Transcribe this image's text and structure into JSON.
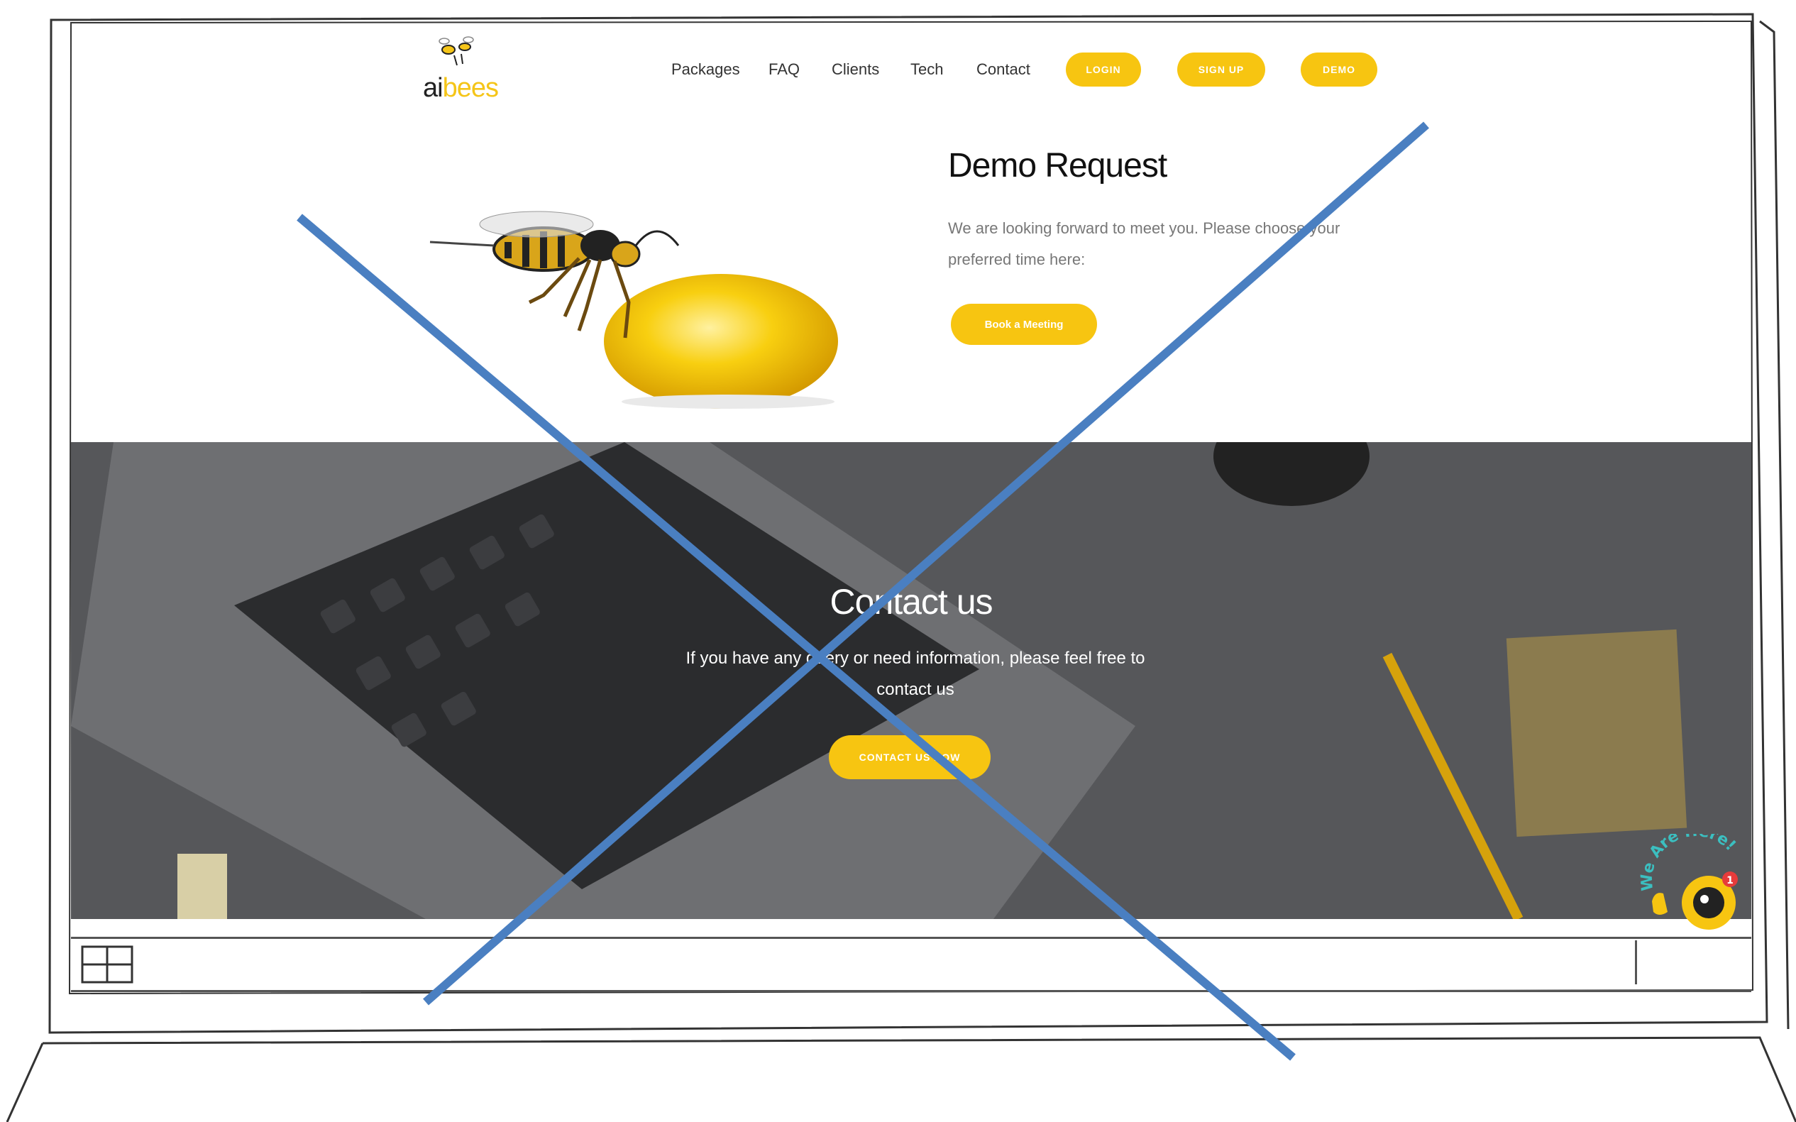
{
  "logo": {
    "ai": "ai",
    "bees": "bees"
  },
  "nav": {
    "links": [
      "Packages",
      "FAQ",
      "Clients",
      "Tech",
      "Contact"
    ],
    "login": "LOGIN",
    "signup": "SIGN UP",
    "demo": "DEMO"
  },
  "demo_section": {
    "title": "Demo Request",
    "text": "We are looking forward to meet you. Please choose your preferred time here:",
    "button": "Book a Meeting"
  },
  "contact_section": {
    "title": "Contact us",
    "text": "If you have any query or need information, please feel free to contact us",
    "button": "CONTACT US NOW"
  },
  "chat_widget": {
    "label": "We Are Here!",
    "badge": "1"
  },
  "colors": {
    "accent": "#f7c511",
    "overlay_dark": "#505154",
    "x_mark": "#4a7fc1"
  },
  "icons": [
    "bee-logo-icon",
    "windows-icon",
    "chat-avatar-icon"
  ]
}
